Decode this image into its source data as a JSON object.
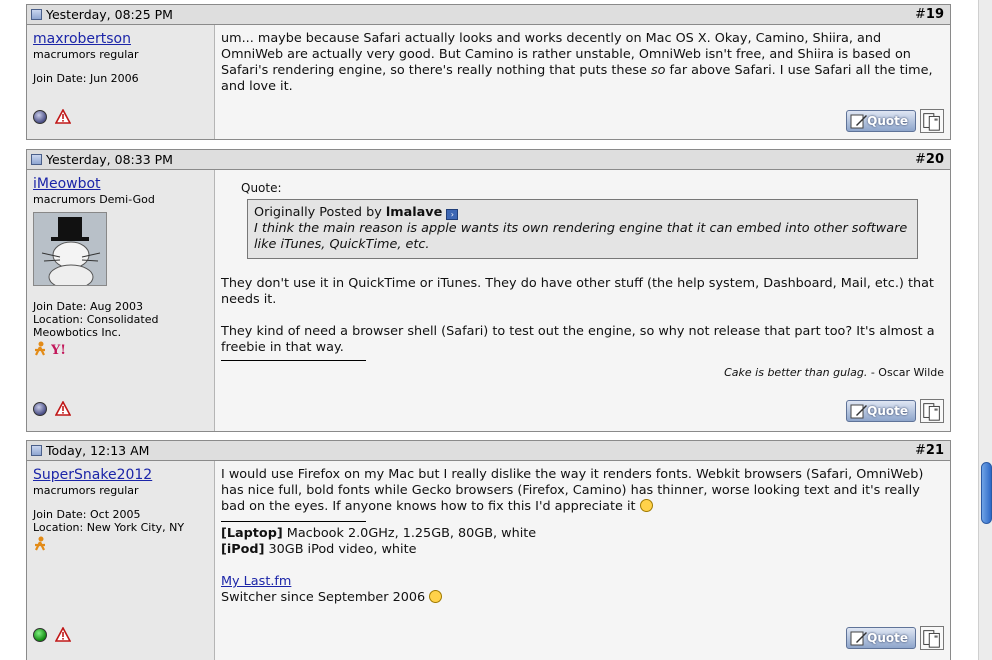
{
  "posts": [
    {
      "date": "Yesterday, 08:25 PM",
      "num_hash": "#",
      "num": "19",
      "username": "maxrobertson",
      "usertitle": "macrumors regular",
      "join": "Join Date: Jun 2006",
      "message": "um... maybe because Safari actually looks and works decently on Mac OS X. Okay, Camino, Shiira, and OmniWeb are actually very good. But Camino is rather unstable, OmniWeb isn't free, and Shiira is based on Safari's rendering engine, so there's really nothing that puts these ",
      "message_em": "so",
      "message_end": " far above Safari. I use Safari all the time, and love it.",
      "quote_label": "Quote"
    },
    {
      "date": "Yesterday, 08:33 PM",
      "num_hash": "#",
      "num": "20",
      "username": "iMeowbot",
      "usertitle": "macrumors Demi-God",
      "join": "Join Date: Aug 2003",
      "location_line1": "Location: Consolidated",
      "location_line2": "Meowbotics Inc.",
      "quote_header": "Quote:",
      "quote_originally": "Originally Posted by ",
      "quote_author": "lmalave",
      "quote_text": "I think the main reason is apple wants its own rendering engine that it can embed into other software like iTunes, QuickTime, etc.",
      "para1": "They don't use it in QuickTime or iTunes. They do have other stuff (the help system, Dashboard, Mail, etc.) that needs it.",
      "para2": "They kind of need a browser shell (Safari) to test out the engine, so why not release that part too? It's almost a freebie in that way.",
      "sig_quote": "Cake is better than gulag.",
      "sig_author": " - Oscar Wilde",
      "quote_label": "Quote"
    },
    {
      "date": "Today, 12:13 AM",
      "num_hash": "#",
      "num": "21",
      "username": "SuperSnake2012",
      "usertitle": "macrumors regular",
      "join": "Join Date: Oct 2005",
      "location": "Location: New York City, NY",
      "message": "I would use Firefox on my Mac but I really dislike the way it renders fonts. Webkit browsers (Safari, OmniWeb) has nice full, bold fonts while Gecko browsers (Firefox, Camino) has thinner, worse looking text and it's really bad on the eyes. If anyone knows how to fix this I'd appreciate it",
      "sig_laptop_label": "[Laptop]",
      "sig_laptop": " Macbook 2.0GHz, 1.25GB, 80GB, white",
      "sig_ipod_label": "[iPod]",
      "sig_ipod": " 30GB iPod video, white",
      "sig_link": "My Last.fm",
      "sig_switch": "Switcher since September 2006",
      "quote_label": "Quote"
    }
  ],
  "colors": {
    "link": "#1b25a8",
    "header_bg": "#dedede",
    "online": "#128a12"
  },
  "icons": [
    "post-icon",
    "status-offline-icon",
    "status-online-icon",
    "report-icon",
    "quote-pen-icon",
    "multiquote-icon",
    "goto-post-icon",
    "smiley-icon",
    "cool-smiley-icon",
    "badge-icon",
    "scroll-thumb"
  ]
}
